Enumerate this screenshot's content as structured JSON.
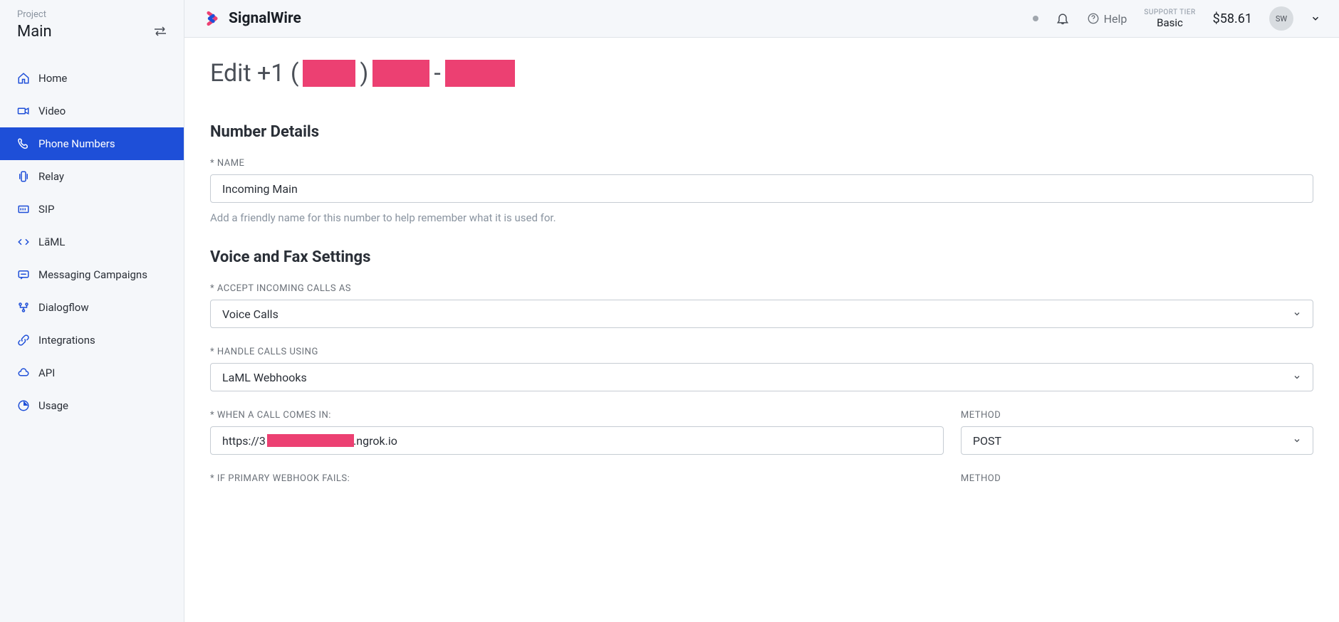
{
  "sidebar": {
    "project_label": "Project",
    "project_name": "Main",
    "items": [
      {
        "icon": "home",
        "label": "Home"
      },
      {
        "icon": "camera",
        "label": "Video"
      },
      {
        "icon": "phone",
        "label": "Phone Numbers"
      },
      {
        "icon": "phone-vib",
        "label": "Relay"
      },
      {
        "icon": "sip",
        "label": "SIP"
      },
      {
        "icon": "code",
        "label": "LāML"
      },
      {
        "icon": "message",
        "label": "Messaging Campaigns"
      },
      {
        "icon": "flow",
        "label": "Dialogflow"
      },
      {
        "icon": "link",
        "label": "Integrations"
      },
      {
        "icon": "cloud",
        "label": "API"
      },
      {
        "icon": "chart",
        "label": "Usage"
      }
    ]
  },
  "topbar": {
    "brand": "SignalWire",
    "help": "Help",
    "tier_label": "SUPPORT TIER",
    "tier_value": "Basic",
    "balance": "$58.61",
    "avatar": "SW"
  },
  "page": {
    "title_prefix": "Edit +1 (",
    "title_mid1": ") ",
    "title_mid2": "-",
    "section_number_details": "Number Details",
    "name_label": "* NAME",
    "name_value": "Incoming Main",
    "name_help": "Add a friendly name for this number to help remember what it is used for.",
    "section_voice_fax": "Voice and Fax Settings",
    "accept_label": "* ACCEPT INCOMING CALLS AS",
    "accept_value": "Voice Calls",
    "handle_label": "* HANDLE CALLS USING",
    "handle_value": "LaML Webhooks",
    "when_call_label": "* WHEN A CALL COMES IN:",
    "when_call_prefix": "https://3",
    "when_call_suffix": "6.ngrok.io",
    "method_label": "METHOD",
    "method_value": "POST",
    "fallback_label": "* IF PRIMARY WEBHOOK FAILS:",
    "method_label2": "METHOD"
  }
}
